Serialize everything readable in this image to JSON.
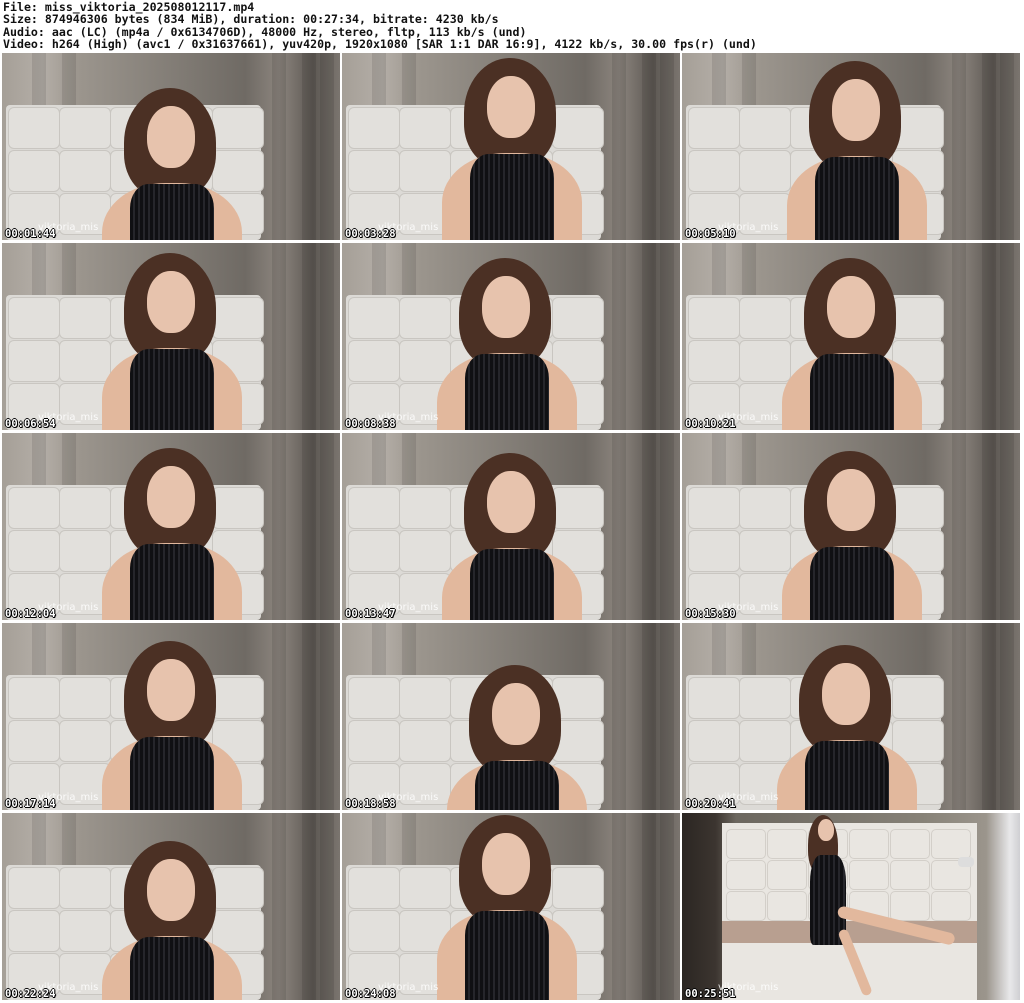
{
  "header": {
    "file_line": "File: miss_viktoria_202508012117.mp4",
    "size_line": "Size: 874946306 bytes (834 MiB), duration: 00:27:34, bitrate: 4230 kb/s",
    "audio_line": "Audio: aac (LC) (mp4a / 0x6134706D), 48000 Hz, stereo, fltp, 113 kb/s (und)",
    "video_line": "Video: h264 (High) (avc1 / 0x31637661), yuv420p, 1920x1080 [SAR 1:1 DAR 16:9], 4122 kb/s, 30.00 fps(r) (und)"
  },
  "thumbnails": [
    {
      "timestamp": "00:01:44",
      "watermark": "viktoria_mis"
    },
    {
      "timestamp": "00:03:28",
      "watermark": "viktoria_mis"
    },
    {
      "timestamp": "00:05:10",
      "watermark": "viktoria_mis"
    },
    {
      "timestamp": "00:06:54",
      "watermark": "viktoria_mis"
    },
    {
      "timestamp": "00:08:38",
      "watermark": "viktoria_mis"
    },
    {
      "timestamp": "00:10:21",
      "watermark": "viktoria_mis"
    },
    {
      "timestamp": "00:12:04",
      "watermark": "viktoria_mis"
    },
    {
      "timestamp": "00:13:47",
      "watermark": "viktoria_mis"
    },
    {
      "timestamp": "00:15:30",
      "watermark": "viktoria_mis"
    },
    {
      "timestamp": "00:17:14",
      "watermark": "viktoria_mis"
    },
    {
      "timestamp": "00:18:58",
      "watermark": "viktoria_mis"
    },
    {
      "timestamp": "00:20:41",
      "watermark": "viktoria_mis"
    },
    {
      "timestamp": "00:22:24",
      "watermark": "viktoria_mis"
    },
    {
      "timestamp": "00:24:08",
      "watermark": "viktoria_mis"
    },
    {
      "timestamp": "00:25:51",
      "watermark": "viktoria_mis"
    }
  ],
  "colors": {
    "background": "#ffffff",
    "header_text": "#111111",
    "timestamp_text": "#ffffff",
    "timestamp_outline": "#000000"
  }
}
